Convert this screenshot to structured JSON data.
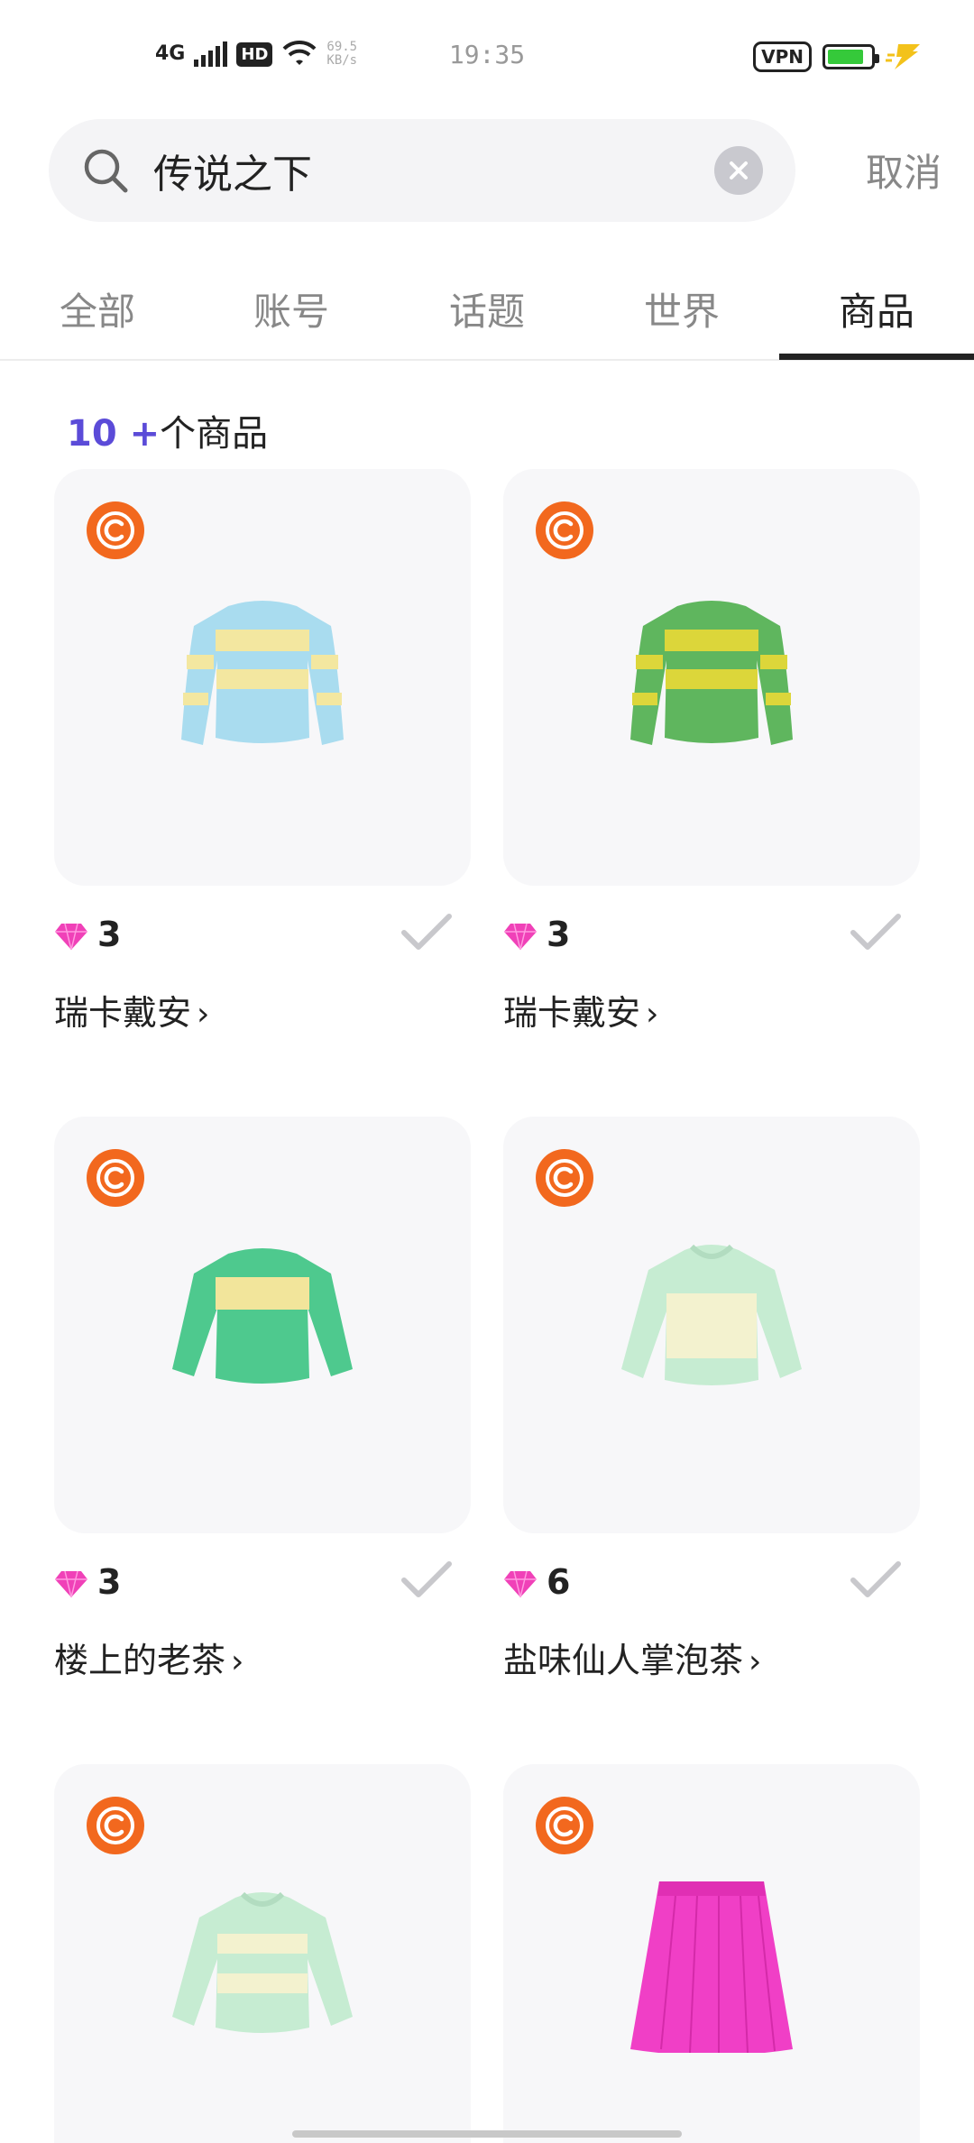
{
  "status_bar": {
    "network": "4G",
    "hd": "HD",
    "speed_value": "69.5",
    "speed_unit": "KB/s",
    "time": "19:35",
    "vpn": "VPN",
    "battery_level": 0.85,
    "battery_color": "#35c93a"
  },
  "search": {
    "query": "传说之下",
    "cancel_label": "取消"
  },
  "tabs": [
    {
      "label": "全部",
      "active": false
    },
    {
      "label": "账号",
      "active": false
    },
    {
      "label": "话题",
      "active": false
    },
    {
      "label": "世界",
      "active": false
    },
    {
      "label": "商品",
      "active": true
    }
  ],
  "results": {
    "count": "10 +",
    "suffix": "个商品"
  },
  "products": [
    {
      "price": "3",
      "seller": "瑞卡戴安",
      "badge_icon": "copyright-badge-icon",
      "item": "sweater-blue-yellow-stripes",
      "item_colors": [
        "#a9dcef",
        "#f3e7a0"
      ]
    },
    {
      "price": "3",
      "seller": "瑞卡戴安",
      "badge_icon": "copyright-badge-icon",
      "item": "sweater-green-yellow-stripes",
      "item_colors": [
        "#5fb65e",
        "#dcd63a"
      ]
    },
    {
      "price": "3",
      "seller": "楼上的老茶",
      "badge_icon": "copyright-badge-icon",
      "item": "sweater-green-yellow-band",
      "item_colors": [
        "#4ec98e",
        "#f2e59b"
      ]
    },
    {
      "price": "6",
      "seller": "盐味仙人掌泡茶",
      "badge_icon": "copyright-badge-icon",
      "item": "hoodie-mint-cream",
      "item_colors": [
        "#c6ecd2",
        "#f3f2cf"
      ]
    },
    {
      "price": "",
      "seller": "",
      "badge_icon": "copyright-badge-icon",
      "item": "hoodie-mint-stripes",
      "item_colors": [
        "#c6ecd2",
        "#f3f2cf"
      ]
    },
    {
      "price": "",
      "seller": "",
      "badge_icon": "copyright-badge-icon",
      "item": "pleated-skirt-pink",
      "item_colors": [
        "#f03fc6",
        "#f03fc6"
      ]
    }
  ],
  "colors": {
    "accent": "#5b4bd8",
    "badge": "#f2681e",
    "gem": "#f041b8"
  }
}
